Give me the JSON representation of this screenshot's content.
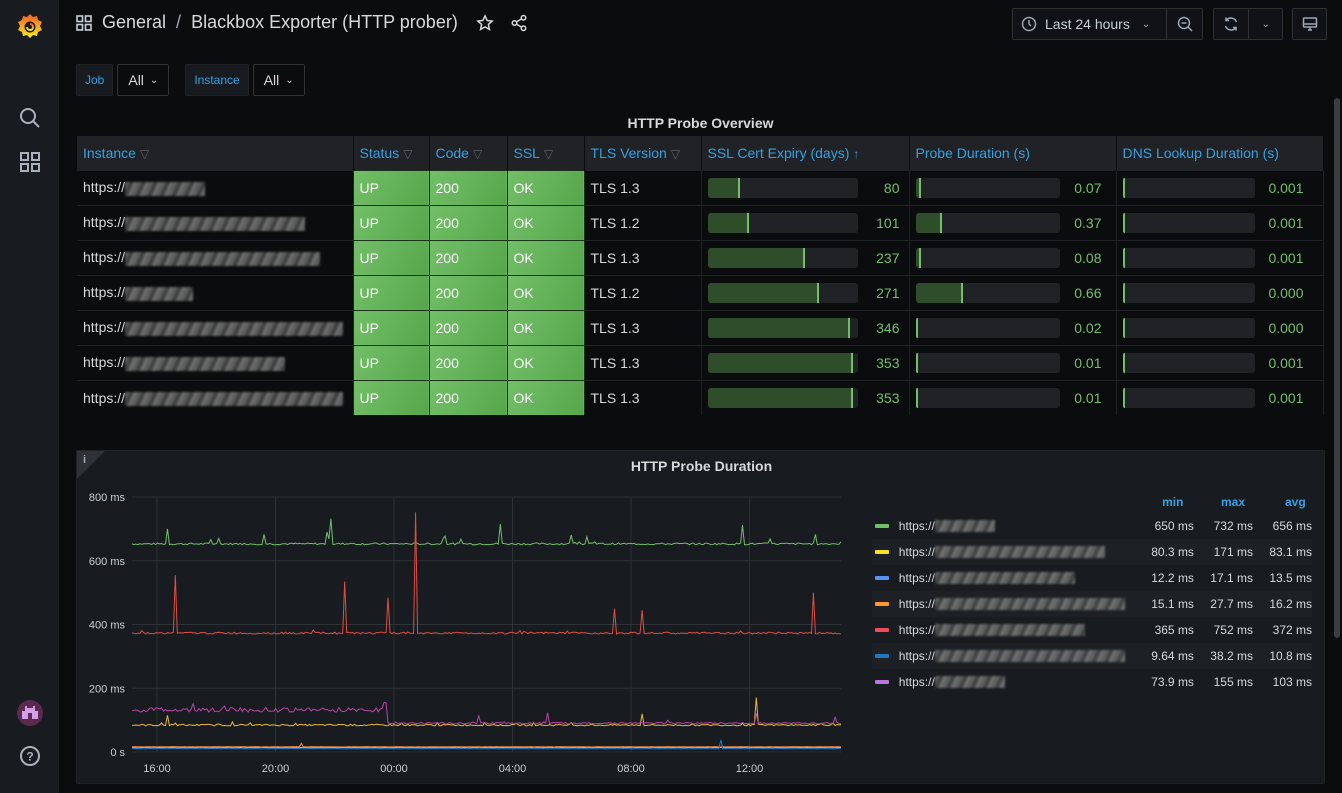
{
  "sidebar": {
    "logo": "grafana-logo-icon",
    "items": [
      {
        "name": "search",
        "icon": "search-icon"
      },
      {
        "name": "dashboards",
        "icon": "dashboards-icon"
      }
    ],
    "bottom": [
      {
        "name": "user-avatar",
        "icon": "avatar"
      },
      {
        "name": "help",
        "icon": "help-icon"
      }
    ]
  },
  "header": {
    "folder": "General",
    "separator": "/",
    "title": "Blackbox Exporter (HTTP prober)",
    "time_range": "Last 24 hours"
  },
  "variables": [
    {
      "label": "Job",
      "value": "All"
    },
    {
      "label": "Instance",
      "value": "All"
    }
  ],
  "table_panel": {
    "title": "HTTP Probe Overview",
    "columns": [
      "Instance",
      "Status",
      "Code",
      "SSL",
      "TLS Version",
      "SSL Cert Expiry (days)",
      "Probe Duration (s)",
      "DNS Lookup Duration (s)"
    ],
    "sort_indicator": "↑",
    "bar_max": {
      "ssl_expiry": 365,
      "probe": 2,
      "dns": 0.5
    },
    "rows": [
      {
        "instance": "https://",
        "status": "UP",
        "code": "200",
        "ssl": "OK",
        "tls": "TLS 1.3",
        "expiry": "80",
        "probe": "0.07",
        "dns": "0.001",
        "blur_len": 80
      },
      {
        "instance": "https://",
        "status": "UP",
        "code": "200",
        "ssl": "OK",
        "tls": "TLS 1.2",
        "expiry": "101",
        "probe": "0.37",
        "dns": "0.001",
        "blur_len": 180
      },
      {
        "instance": "https://",
        "status": "UP",
        "code": "200",
        "ssl": "OK",
        "tls": "TLS 1.3",
        "expiry": "237",
        "probe": "0.08",
        "dns": "0.001",
        "blur_len": 195
      },
      {
        "instance": "https://",
        "status": "UP",
        "code": "200",
        "ssl": "OK",
        "tls": "TLS 1.2",
        "expiry": "271",
        "probe": "0.66",
        "dns": "0.000",
        "blur_len": 68
      },
      {
        "instance": "https://",
        "status": "UP",
        "code": "200",
        "ssl": "OK",
        "tls": "TLS 1.3",
        "expiry": "346",
        "probe": "0.02",
        "dns": "0.000",
        "blur_len": 218
      },
      {
        "instance": "https://",
        "status": "UP",
        "code": "200",
        "ssl": "OK",
        "tls": "TLS 1.3",
        "expiry": "353",
        "probe": "0.01",
        "dns": "0.001",
        "blur_len": 160
      },
      {
        "instance": "https://",
        "status": "UP",
        "code": "200",
        "ssl": "OK",
        "tls": "TLS 1.3",
        "expiry": "353",
        "probe": "0.01",
        "dns": "0.001",
        "blur_len": 218
      }
    ]
  },
  "graph_panel": {
    "title": "HTTP Probe Duration",
    "info": "i",
    "legend_headers": [
      "min",
      "max",
      "avg"
    ],
    "legend": [
      {
        "name": "https://",
        "color": "#73bf69",
        "min": "650 ms",
        "max": "732 ms",
        "avg": "656 ms"
      },
      {
        "name": "https://",
        "color": "#fade2a",
        "min": "80.3 ms",
        "max": "171 ms",
        "avg": "83.1 ms"
      },
      {
        "name": "https://",
        "color": "#5794f2",
        "min": "12.2 ms",
        "max": "17.1 ms",
        "avg": "13.5 ms"
      },
      {
        "name": "https://",
        "color": "#ff9830",
        "min": "15.1 ms",
        "max": "27.7 ms",
        "avg": "16.2 ms"
      },
      {
        "name": "https://",
        "color": "#f2495c",
        "min": "365 ms",
        "max": "752 ms",
        "avg": "372 ms"
      },
      {
        "name": "https://",
        "color": "#1f78c1",
        "min": "9.64 ms",
        "max": "38.2 ms",
        "avg": "10.8 ms"
      },
      {
        "name": "https://",
        "color": "#b877d9",
        "min": "73.9 ms",
        "max": "155 ms",
        "avg": "103 ms"
      }
    ]
  },
  "chart_data": {
    "type": "line",
    "title": "HTTP Probe Duration",
    "xlabel": "",
    "ylabel": "",
    "x_ticks": [
      "16:00",
      "20:00",
      "00:00",
      "04:00",
      "08:00",
      "12:00"
    ],
    "y_ticks": [
      "0 s",
      "200 ms",
      "400 ms",
      "600 ms",
      "800 ms"
    ],
    "ylim_ms": [
      0,
      800
    ],
    "x_range_hours": [
      -24,
      0
    ],
    "grid": true,
    "legend_position": "right",
    "series": [
      {
        "name": "https:// (1)",
        "color": "#73bf69",
        "baseline_ms": 650,
        "spikes": [
          [
            0.05,
            700
          ],
          [
            0.28,
            732
          ],
          [
            0.52,
            715
          ],
          [
            0.86,
            712
          ]
        ],
        "min_ms": 650,
        "max_ms": 732,
        "avg_ms": 656
      },
      {
        "name": "https:// (2)",
        "color": "#eab839",
        "baseline_ms": 82,
        "spikes": [
          [
            0.05,
            115
          ],
          [
            0.72,
            120
          ],
          [
            0.88,
            171
          ]
        ],
        "min_ms": 80.3,
        "max_ms": 171,
        "avg_ms": 83.1
      },
      {
        "name": "https:// (3)",
        "color": "#6ed0e0",
        "baseline_ms": 13.5,
        "spikes": [],
        "min_ms": 12.2,
        "max_ms": 17.1,
        "avg_ms": 13.5
      },
      {
        "name": "https:// (4)",
        "color": "#ef843c",
        "baseline_ms": 16,
        "spikes": [
          [
            0.24,
            27.7
          ]
        ],
        "min_ms": 15.1,
        "max_ms": 27.7,
        "avg_ms": 16.2
      },
      {
        "name": "https:// (5)",
        "color": "#e24d42",
        "baseline_ms": 370,
        "spikes": [
          [
            0.06,
            555
          ],
          [
            0.3,
            535
          ],
          [
            0.36,
            484
          ],
          [
            0.4,
            752
          ],
          [
            0.68,
            450
          ],
          [
            0.72,
            445
          ],
          [
            0.96,
            500
          ]
        ],
        "min_ms": 365,
        "max_ms": 752,
        "avg_ms": 372
      },
      {
        "name": "https:// (6)",
        "color": "#1f78c1",
        "baseline_ms": 10,
        "spikes": [
          [
            0.83,
            38.2
          ]
        ],
        "min_ms": 9.64,
        "max_ms": 38.2,
        "avg_ms": 10.8
      },
      {
        "name": "https:// (7)",
        "color": "#ba43a9",
        "baseline_ms": 125,
        "step_at": 0.36,
        "after_ms": 88,
        "min_ms": 73.9,
        "max_ms": 155,
        "avg_ms": 103
      }
    ]
  }
}
